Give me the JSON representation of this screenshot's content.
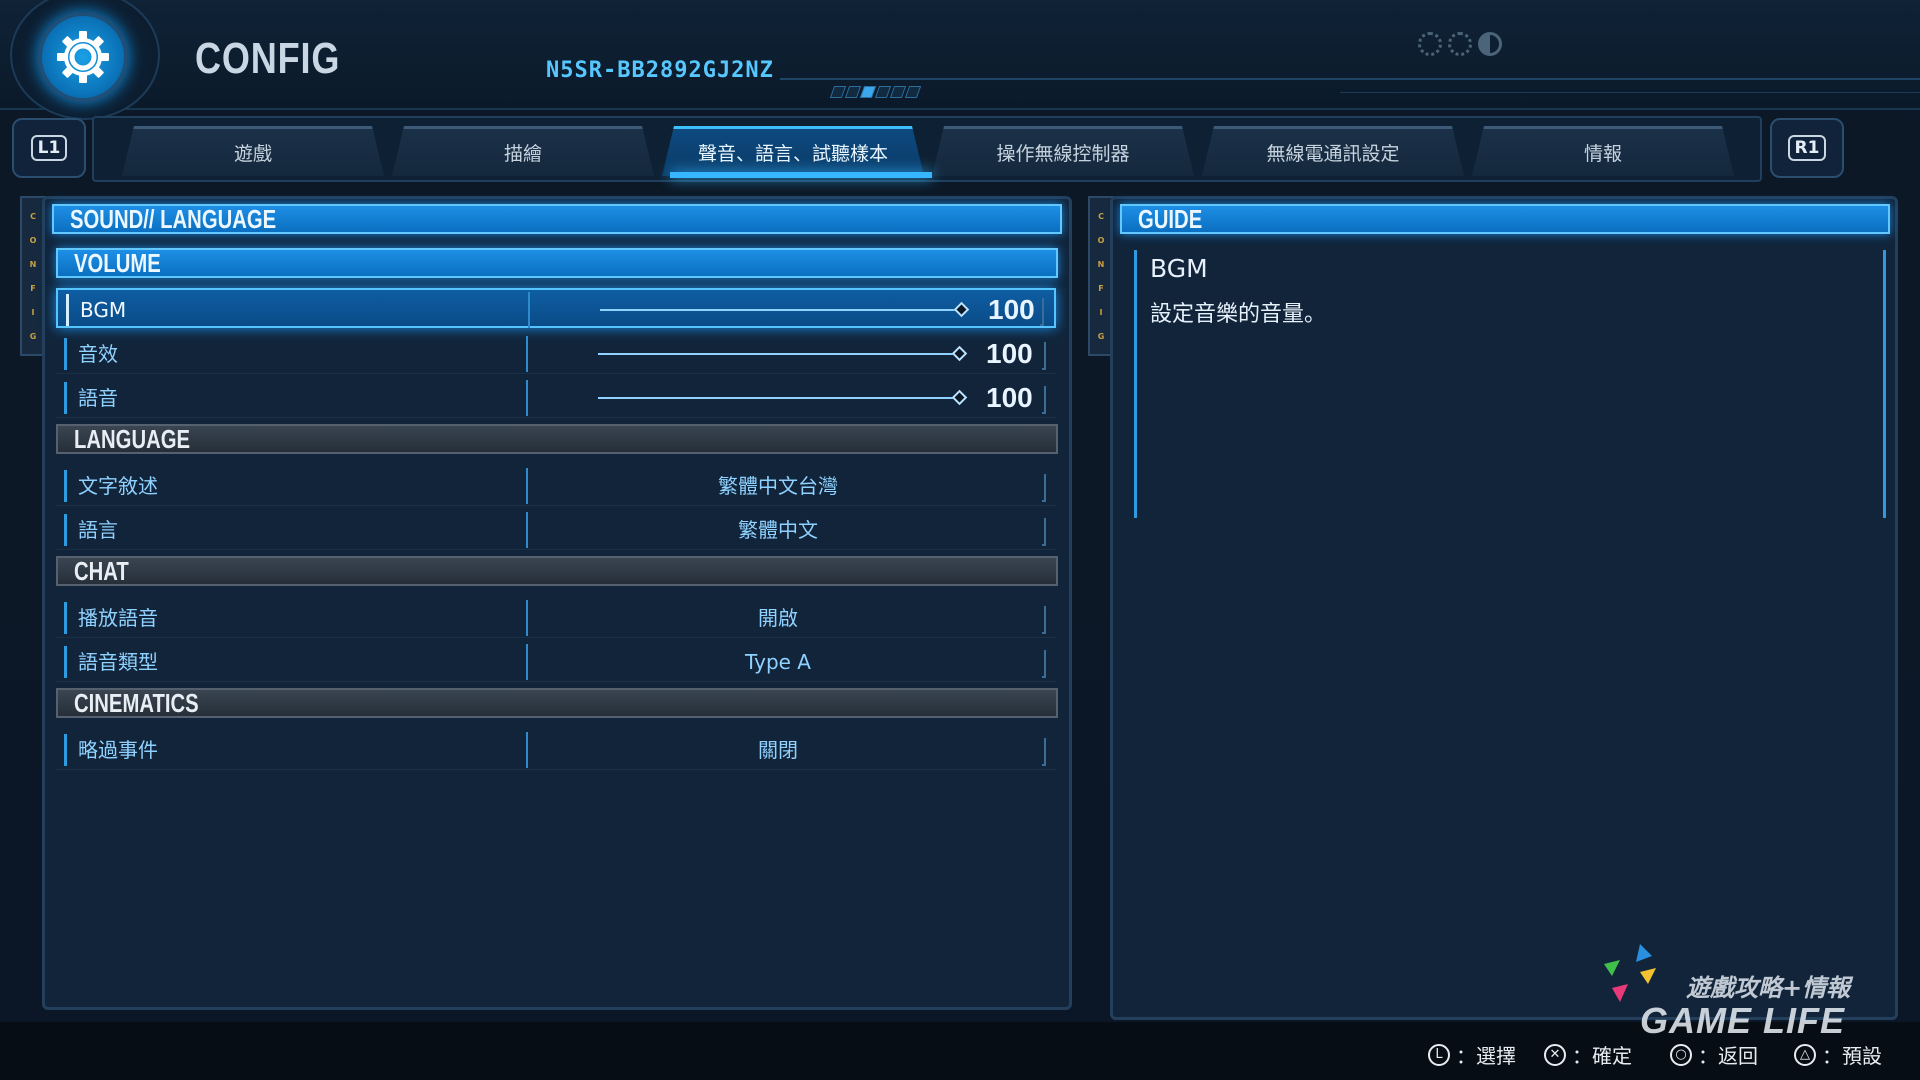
{
  "header": {
    "title": "CONFIG",
    "device_id": "N5SR-BB2892GJ2NZ"
  },
  "shoulders": {
    "left": "L1",
    "right": "R1"
  },
  "tabs": [
    {
      "label": "遊戲"
    },
    {
      "label": "描繪"
    },
    {
      "label": "聲音、語言、試聽樣本",
      "active": true
    },
    {
      "label": "操作無線控制器"
    },
    {
      "label": "無線電通訊設定"
    },
    {
      "label": "情報"
    }
  ],
  "side_strip_letters": [
    "C",
    "O",
    "N",
    "F",
    "I",
    "G"
  ],
  "left_panel": {
    "title": "SOUND// LANGUAGE",
    "volume": {
      "heading": "VOLUME",
      "items": [
        {
          "label": "BGM",
          "value": "100",
          "level": 1.0,
          "selected": true
        },
        {
          "label": "音效",
          "value": "100",
          "level": 1.0
        },
        {
          "label": "語音",
          "value": "100",
          "level": 1.0
        }
      ]
    },
    "language": {
      "heading": "LANGUAGE",
      "items": [
        {
          "label": "文字敘述",
          "value": "繁體中文台灣"
        },
        {
          "label": "語言",
          "value": "繁體中文"
        }
      ]
    },
    "chat": {
      "heading": "CHAT",
      "items": [
        {
          "label": "播放語音",
          "value": "開啟"
        },
        {
          "label": "語音類型",
          "value": "Type A"
        }
      ]
    },
    "cinematics": {
      "heading": "CINEMATICS",
      "items": [
        {
          "label": "略過事件",
          "value": "關閉"
        }
      ]
    }
  },
  "guide": {
    "heading": "GUIDE",
    "title": "BGM",
    "description": "設定音樂的音量。"
  },
  "footer_hints": [
    {
      "icon": "left-stick-icon",
      "label": "：選擇"
    },
    {
      "icon": "cross-button-icon",
      "label": "：確定"
    },
    {
      "icon": "circle-button-icon",
      "label": "：返回"
    },
    {
      "icon": "triangle-button-icon",
      "label": "：預設"
    }
  ],
  "watermark": {
    "cn": "遊戲攻略+情報",
    "en": "GAME LIFE"
  },
  "colors": {
    "accent": "#1d8fe6",
    "text_blue": "#8fd1ff",
    "background": "#0c1826"
  }
}
